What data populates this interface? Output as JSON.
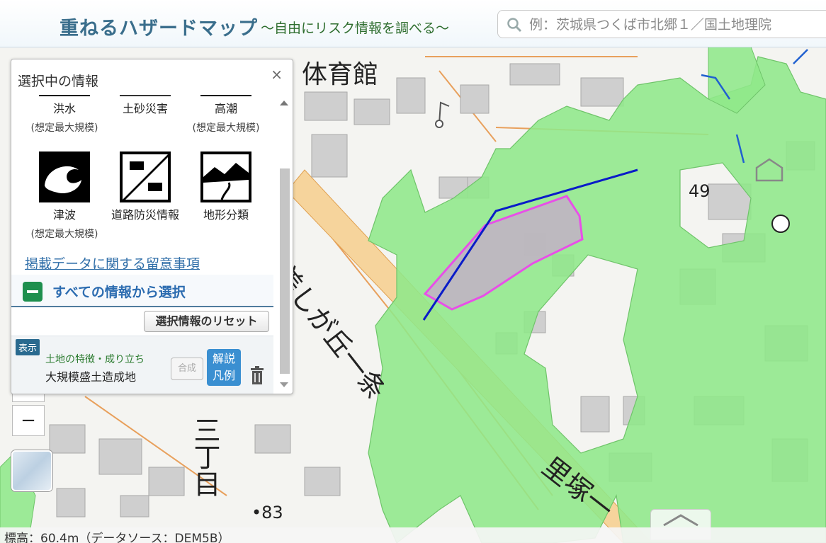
{
  "header": {
    "title": "重ねるハザードマップ",
    "subtitle": "～自由にリスク情報を調べる～",
    "search_placeholder": "例：茨城県つくば市北郷１／国土地理院"
  },
  "panel": {
    "title": "選択中の情報",
    "close_symbol": "×",
    "hazards": [
      {
        "label": "洪水",
        "sub": "(想定最大規模)",
        "icon": "flood-icon"
      },
      {
        "label": "土砂災害",
        "sub": "",
        "icon": "landslide-icon"
      },
      {
        "label": "高潮",
        "sub": "(想定最大規模)",
        "icon": "storm-surge-icon"
      },
      {
        "label": "津波",
        "sub": "(想定最大規模)",
        "icon": "tsunami-icon"
      },
      {
        "label": "道路防災情報",
        "sub": "",
        "icon": "road-disaster-icon"
      },
      {
        "label": "地形分類",
        "sub": "",
        "icon": "terrain-icon"
      }
    ],
    "notice_link": "掲載データに関する留意事項",
    "select_all_label": "すべての情報から選択",
    "reset_label": "選択情報のリセット",
    "layer": {
      "badge": "表示",
      "category": "土地の特徴・成り立ち",
      "name": "大規模盛土造成地",
      "compose_label": "合成",
      "legend_label_1": "解説",
      "legend_label_2": "凡例"
    }
  },
  "map": {
    "labels": {
      "gym": "体育館",
      "area_utsukushigaoka": "美しが丘一条",
      "area_sanchome": "三丁目",
      "area_satozuka": "里塚一",
      "spot_49": "49",
      "spot_83": "•83"
    },
    "colors": {
      "fill_green": "#8fe88a",
      "fill_green_edge": "#6fc46a",
      "polygon_magenta": "#e84fe8",
      "line_blue": "#0a1cc8",
      "road_orange": "#e8a05c",
      "building_gray": "#c8c8c8"
    }
  },
  "controls": {
    "zoom_in": "+",
    "zoom_out": "−"
  },
  "status": {
    "elevation": "標高：60.4m（データソース：DEM5B）"
  }
}
